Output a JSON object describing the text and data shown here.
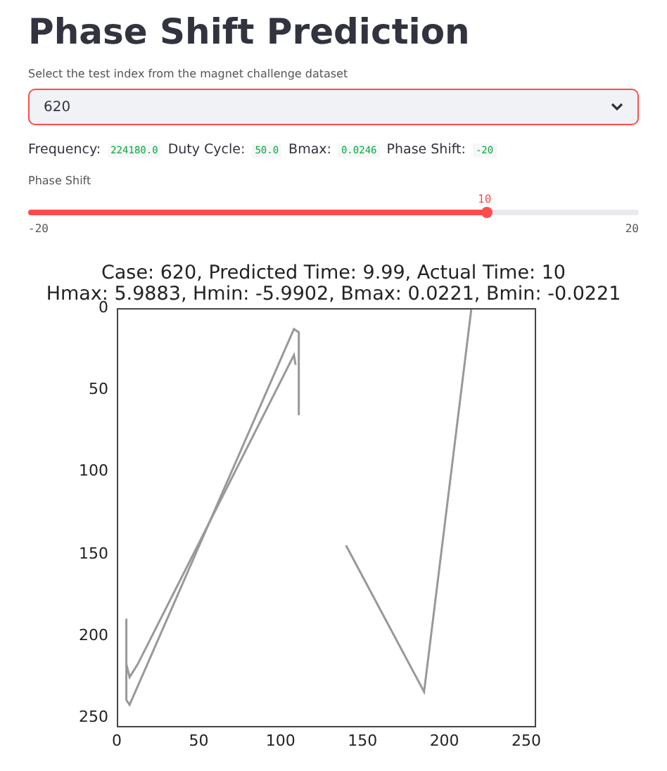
{
  "title": "Phase Shift Prediction",
  "select": {
    "label": "Select the test index from the magnet challenge dataset",
    "value": "620",
    "focused": true
  },
  "info": [
    {
      "label": "Frequency:",
      "value": "224180.0"
    },
    {
      "label": "Duty Cycle:",
      "value": "50.0"
    },
    {
      "label": "Bmax:",
      "value": "0.0246"
    },
    {
      "label": "Phase Shift:",
      "value": "-20"
    }
  ],
  "slider": {
    "label": "Phase Shift",
    "value": "10",
    "level": 0.75,
    "min": "-20",
    "max": "20"
  },
  "plot": {
    "title_lines": [
      "Case: 620, Predicted Time: 9.99, Actual Time: 10",
      "Hmax: 5.9883, Hmin: -5.9902, Bmax: 0.0221, Bmin: -0.0221"
    ],
    "yticks": [
      "0",
      "50",
      "100",
      "150",
      "200",
      "250"
    ],
    "xticks": [
      "0",
      "50",
      "100",
      "150",
      "200",
      "250"
    ]
  }
}
